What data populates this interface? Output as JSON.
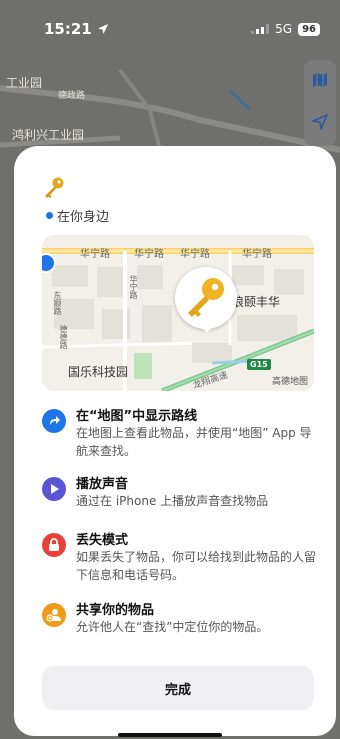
{
  "status_bar": {
    "time": "15:21",
    "network": "5G",
    "battery": "96"
  },
  "background_map": {
    "labels": [
      "工业园",
      "德政路",
      "鸿利兴工业园"
    ]
  },
  "sheet": {
    "item_icon": "key-icon",
    "nearby_text": "在你身边",
    "mini_map": {
      "road_top_1": "华宁路",
      "road_top_2": "华宁路",
      "road_top_3": "华宁路",
      "road_top_4": "华宁路",
      "vert_road": "华宁路",
      "side_road": "东顺路",
      "area_label": "大浪颐丰华",
      "bottom_left": "国乐科技园",
      "bottom_road": "龙翔高速",
      "highway_badge": "G15",
      "vendor_left": "德德路",
      "legal": "高德地图"
    },
    "actions": [
      {
        "icon": "directions-icon",
        "color": "#1e74e8",
        "title": "在“地图”中显示路线",
        "desc": "在地图上查看此物品，并使用“地图” App 导航来查找。"
      },
      {
        "icon": "play-sound-icon",
        "color": "#5b54d6",
        "title": "播放声音",
        "desc": "通过在 iPhone 上播放声音查找物品"
      },
      {
        "icon": "lock-icon",
        "color": "#e8403a",
        "title": "丢失模式",
        "desc": "如果丢失了物品，你可以给找到此物品的人留下信息和电话号码。"
      },
      {
        "icon": "share-people-icon",
        "color": "#f09a1a",
        "title": "共享你的物品",
        "desc": "允许他人在“查找”中定位你的物品。"
      }
    ],
    "done_label": "完成"
  }
}
